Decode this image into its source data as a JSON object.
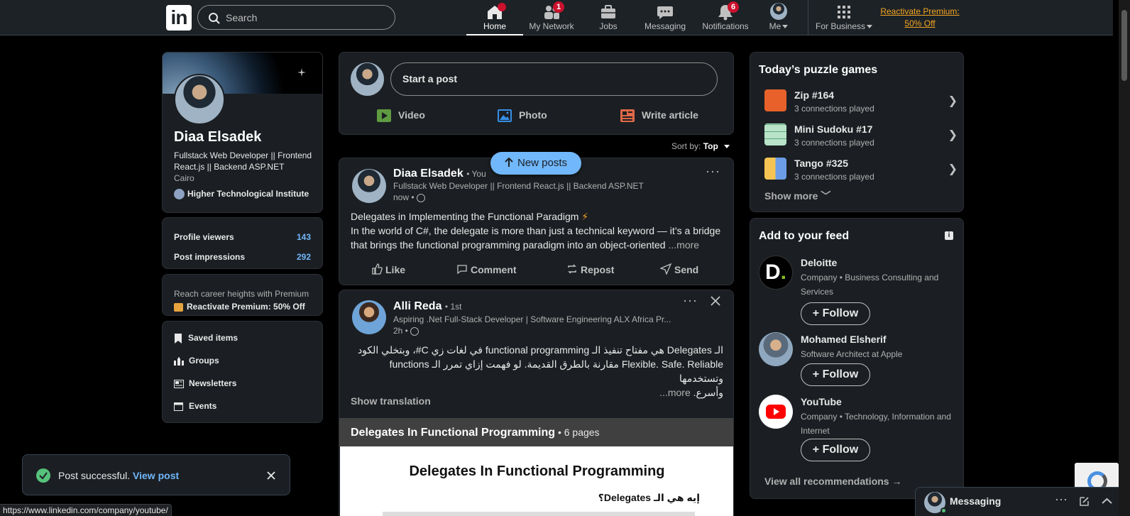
{
  "nav": {
    "search_placeholder": "Search",
    "items": [
      {
        "label": "Home",
        "badge": ""
      },
      {
        "label": "My Network",
        "badge": "1"
      },
      {
        "label": "Jobs",
        "badge": ""
      },
      {
        "label": "Messaging",
        "badge": ""
      },
      {
        "label": "Notifications",
        "badge": "6"
      },
      {
        "label": "Me",
        "badge": ""
      }
    ],
    "for_business": "For Business",
    "premium_line1": "Reactivate Premium:",
    "premium_line2": "50% Off"
  },
  "profile": {
    "name": "Diaa Elsadek",
    "headline": "Fullstack Web Developer || Frontend React.js || Backend ASP.NET",
    "location": "Cairo",
    "school": "Higher Technological Institute",
    "stats": [
      {
        "label": "Profile viewers",
        "value": "143"
      },
      {
        "label": "Post impressions",
        "value": "292"
      }
    ],
    "premium_prompt": "Reach career heights with Premium",
    "premium_cta": "Reactivate Premium: 50% Off",
    "links": [
      "Saved items",
      "Groups",
      "Newsletters",
      "Events"
    ]
  },
  "composer": {
    "placeholder": "Start a post",
    "video": "Video",
    "photo": "Photo",
    "article": "Write article"
  },
  "sort": {
    "label": "Sort by:",
    "value": "Top"
  },
  "new_posts": "New posts",
  "post1": {
    "author": "Diaa Elsadek",
    "relation": "• You",
    "headline": "Fullstack Web Developer || Frontend React.js || Backend ASP.NET",
    "time": "now •",
    "line1": "Delegates in Implementing the Functional Paradigm",
    "line2": "In the world of C#, the delegate is more than just a technical keyword — it’s a bridge",
    "line3": "that brings the functional programming paradigm into an object-oriented",
    "more": "...more",
    "actions": [
      "Like",
      "Comment",
      "Repost",
      "Send"
    ]
  },
  "post2": {
    "author": "Alli Reda",
    "relation": "• 1st",
    "headline": "Aspiring .Net Full-Stack Developer | Software Engineering ALX Africa Pr...",
    "time": "2h •",
    "line1": "الـ Delegates هي مفتاح تنفيذ الـ functional programming في لغات زي C#، وبتخلي الكود",
    "line2": "Flexible. Safe. Reliable مقارنة بالطرق القديمة. لو فهمت إزاي تمرر الـ functions وتستخدمها",
    "line3": "وأسرع.",
    "more": "...more",
    "show_translation": "Show translation",
    "doc_title": "Delegates In Functional Programming",
    "doc_pages": "• 6 pages",
    "doc_heading": "Delegates In Functional Programming",
    "doc_sub": "إيه هي الـ Delegates؟"
  },
  "games": {
    "title": "Today’s puzzle games",
    "items": [
      {
        "name": "Zip #164",
        "sub": "3 connections played"
      },
      {
        "name": "Mini Sudoku #17",
        "sub": "3 connections played"
      },
      {
        "name": "Tango #325",
        "sub": "3 connections played"
      }
    ],
    "show_more": "Show more"
  },
  "feed": {
    "title": "Add to your feed",
    "items": [
      {
        "name": "Deloitte",
        "desc": "Company • Business Consulting and Services"
      },
      {
        "name": "Mohamed Elsherif",
        "desc": "Software Architect at Apple"
      },
      {
        "name": "YouTube",
        "desc": "Company • Technology, Information and Internet"
      }
    ],
    "follow": "Follow",
    "view_all": "View all recommendations"
  },
  "toast": {
    "text": "Post successful.",
    "link": "View post"
  },
  "status_url": "https://www.linkedin.com/company/youtube/",
  "messaging": "Messaging",
  "colors": {
    "bg": "#000000",
    "card": "#1b1f23",
    "link": "#71b7fb",
    "premium": "#f5a623",
    "badge": "#cb112d"
  }
}
